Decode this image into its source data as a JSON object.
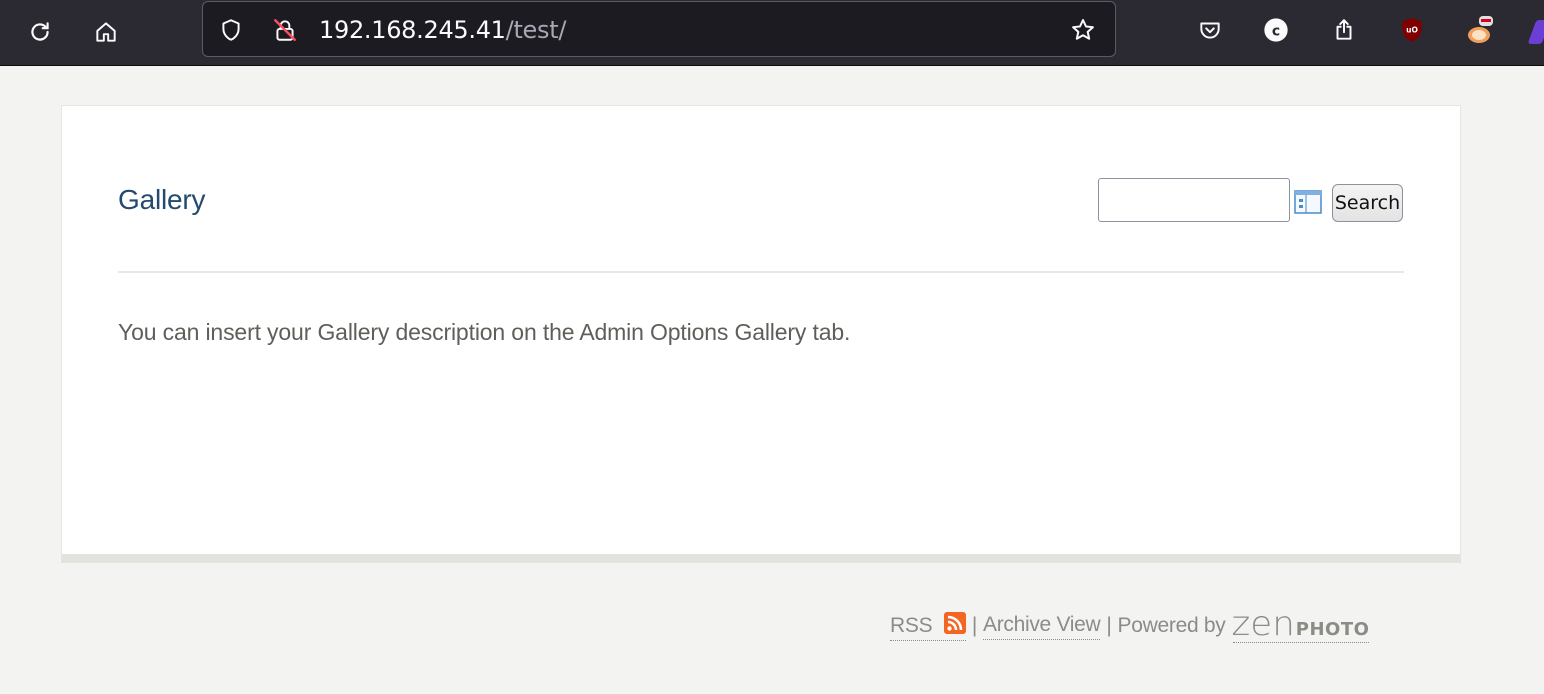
{
  "browser": {
    "url_host": "192.168.245.41",
    "url_path": "/test/",
    "toolbar_icons": [
      "reload-icon",
      "home-icon",
      "shield-icon",
      "insecure-lock-icon",
      "star-icon",
      "pocket-icon",
      "extension-c-icon",
      "share-icon",
      "ublock-icon",
      "foxy-icon"
    ]
  },
  "page": {
    "gallery_title": "Gallery",
    "search": {
      "value": "",
      "placeholder": "",
      "button_label": "Search"
    },
    "description": "You can insert your Gallery description on the Admin Options Gallery tab."
  },
  "footer": {
    "rss_label": "RSS",
    "separator": "|",
    "archive_label": "Archive View",
    "powered_by_label": "Powered by",
    "logo_zen": "zen",
    "logo_photo": "PHOTO"
  },
  "colors": {
    "toolbar_bg": "#2b2a33",
    "page_bg": "#f3f3f1",
    "title_link": "#244a6f",
    "rss_orange": "#f26522"
  }
}
